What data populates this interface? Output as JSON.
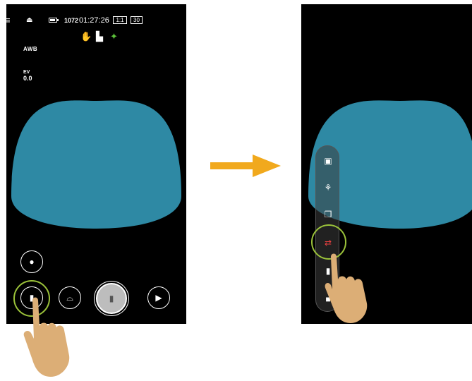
{
  "left_screen": {
    "status_bar": {
      "menu_icon": "menu-icon",
      "eject_icon": "eject-icon",
      "battery_icon": "battery-icon",
      "shots_remaining": "1072",
      "time_remaining": "01:27:26",
      "aspect_ratio": "1:1",
      "frame_rate": "30"
    },
    "mode_icons": [
      "stabilizer-icon",
      "video-mode-icon",
      "motion-icon"
    ],
    "white_balance": "AWB",
    "exposure": {
      "label": "EV",
      "value": "0.0"
    },
    "controls": {
      "snapshot_icon": "photo-capture-icon",
      "mode_button_icon": "video-mode-icon",
      "view_button_icon": "dome-view-icon",
      "record_button_icon": "video-camera-icon",
      "playback_button_icon": "play-icon"
    }
  },
  "right_screen": {
    "mode_list": [
      {
        "icon": "photo-frame-icon",
        "selected": false
      },
      {
        "icon": "video-bike-icon",
        "selected": false
      },
      {
        "icon": "burst-icon",
        "selected": false
      },
      {
        "icon": "loop-recording-icon",
        "selected": true
      },
      {
        "icon": "video-camera-icon",
        "selected": false
      },
      {
        "icon": "photo-camera-icon",
        "selected": false
      }
    ]
  },
  "colors": {
    "preview_dome": "#2e89a4",
    "highlight_ring": "#9bc23a",
    "arrow": "#f1a91d",
    "hand": "#dcae76",
    "selected_mode": "#e84040"
  }
}
